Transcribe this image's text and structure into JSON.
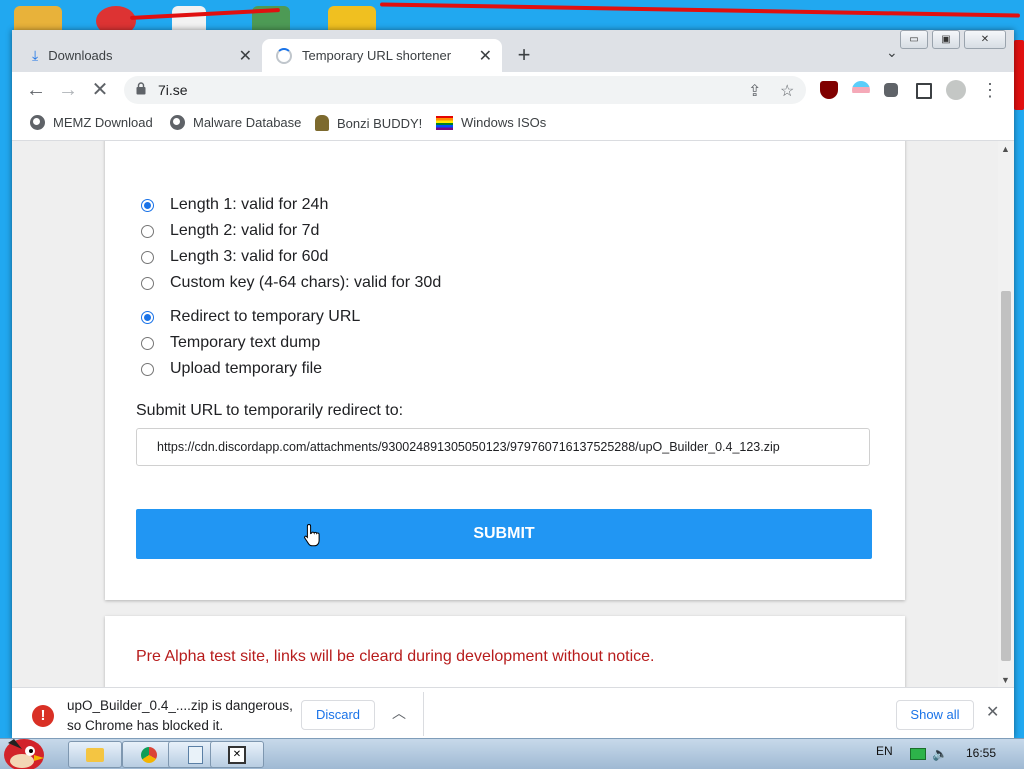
{
  "window": {
    "tabs": [
      {
        "label": "Downloads",
        "icon": "download-icon"
      },
      {
        "label": "Temporary URL shortener",
        "icon": "loading-icon"
      }
    ],
    "address": "7i.se",
    "bookmarks": [
      {
        "label": "MEMZ Download",
        "icon": "globe-icon"
      },
      {
        "label": "Malware Database",
        "icon": "globe-icon"
      },
      {
        "label": "Bonzi BUDDY!",
        "icon": "bonzi-icon"
      },
      {
        "label": "Windows ISOs",
        "icon": "rainbow-flag-icon"
      }
    ]
  },
  "form": {
    "length_options": [
      {
        "label": "Length 1: valid for 24h",
        "checked": true
      },
      {
        "label": "Length 2: valid for 7d",
        "checked": false
      },
      {
        "label": "Length 3: valid for 60d",
        "checked": false
      },
      {
        "label": "Custom key (4-64 chars): valid for 30d",
        "checked": false
      }
    ],
    "mode_options": [
      {
        "label": "Redirect to temporary URL",
        "checked": true
      },
      {
        "label": "Temporary text dump",
        "checked": false
      },
      {
        "label": "Upload temporary file",
        "checked": false
      }
    ],
    "field_label": "Submit URL to temporarily redirect to:",
    "url_value": "https://cdn.discordapp.com/attachments/930024891305050123/979760716137525288/upO_Builder_0.4_123.zip",
    "submit_label": "SUBMIT"
  },
  "notice": "Pre Alpha test site, links will be cleard during development without notice.",
  "download_bar": {
    "message_line1": "upO_Builder_0.4_....zip is dangerous,",
    "message_line2": "so Chrome has blocked it.",
    "discard_label": "Discard",
    "show_all_label": "Show all"
  },
  "taskbar": {
    "language": "EN",
    "time": "16:55"
  },
  "colors": {
    "accent": "#2196f3",
    "notice": "#b71c1c",
    "danger": "#d93025"
  }
}
